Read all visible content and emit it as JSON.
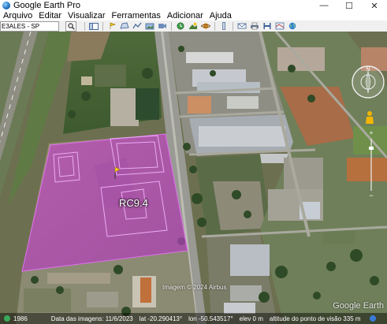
{
  "window": {
    "title": "Google Earth Pro",
    "minimize_glyph": "—",
    "maximize_glyph": "☐",
    "close_glyph": "✕"
  },
  "menu": {
    "items": [
      {
        "label": "Arquivo"
      },
      {
        "label": "Editar"
      },
      {
        "label": "Visualizar"
      },
      {
        "label": "Ferramentas"
      },
      {
        "label": "Adicionar"
      },
      {
        "label": "Ajuda"
      }
    ]
  },
  "search": {
    "value": "E3ALES - SP"
  },
  "toolbar_icons": [
    "sidebar-toggle-icon",
    "add-placemark-icon",
    "add-polygon-icon",
    "add-path-icon",
    "add-overlay-icon",
    "record-tour-icon",
    "historical-imagery-icon",
    "sunlight-icon",
    "planets-icon",
    "ruler-icon",
    "email-icon",
    "print-icon",
    "save-image-icon",
    "view-in-maps-icon",
    "earth-gallery-icon"
  ],
  "map": {
    "placemark_label": "RC9.4",
    "imagery_credit": "Imagem © 2024 Airbus",
    "watermark": "Google Earth",
    "compass_north": "N",
    "polygon_color": "#c23fd0",
    "accent_blue": "#1f6fbf"
  },
  "status": {
    "scale": "1986",
    "date": "Data das imagens: 11/6/2023",
    "lat": "lat -20.290413°",
    "lon": "lon -50.543517°",
    "elev": "elev 0 m",
    "eye_alt": "altitude do ponto de visão 335 m"
  }
}
